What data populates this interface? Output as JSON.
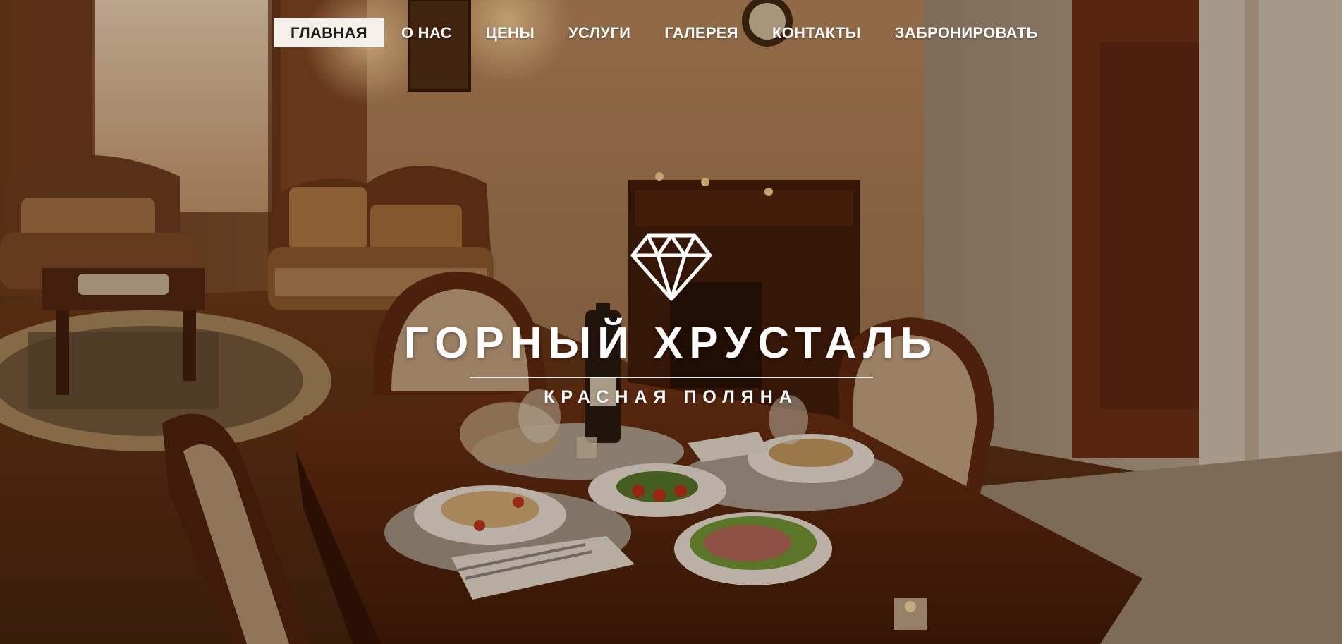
{
  "nav": {
    "items": [
      {
        "label": "ГЛАВНАЯ",
        "active": true
      },
      {
        "label": "О НАС",
        "active": false
      },
      {
        "label": "ЦЕНЫ",
        "active": false
      },
      {
        "label": "УСЛУГИ",
        "active": false
      },
      {
        "label": "ГАЛЕРЕЯ",
        "active": false
      },
      {
        "label": "КОНТАКТЫ",
        "active": false
      },
      {
        "label": "ЗАБРОНИРОВАТЬ",
        "active": false
      }
    ]
  },
  "logo": {
    "icon": "diamond-icon",
    "title": "ГОРНЫЙ ХРУСТАЛЬ",
    "subtitle": "КРАСНАЯ ПОЛЯНА"
  },
  "colors": {
    "active_nav_bg": "#f4efe9",
    "active_nav_text": "#1c1c1c",
    "nav_text": "#ffffff"
  }
}
